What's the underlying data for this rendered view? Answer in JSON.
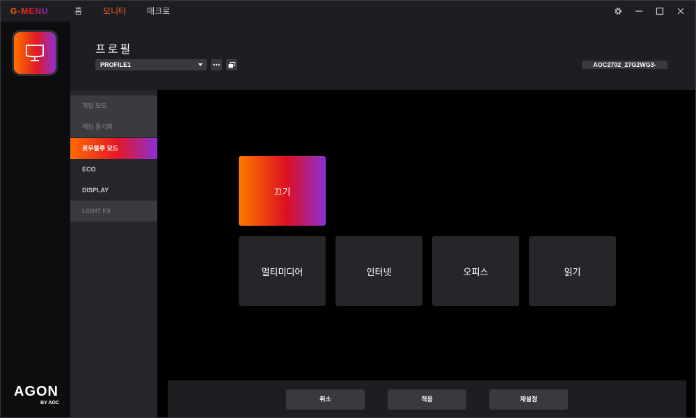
{
  "app": {
    "brand": "G-MENU"
  },
  "nav": {
    "tabs": [
      {
        "label": "홈"
      },
      {
        "label": "모니터"
      },
      {
        "label": "매크로"
      }
    ],
    "active": "모니터"
  },
  "header": {
    "title": "프로필",
    "profile_select": "PROFILE1",
    "monitor_model": "AOC2702_27G2WG3-"
  },
  "submenu": {
    "items": [
      {
        "label": "게임 모드",
        "state": "dim"
      },
      {
        "label": "게임 동기화",
        "state": "dim"
      },
      {
        "label": "로우블루 모드",
        "state": "active"
      },
      {
        "label": "ECO",
        "state": "normal"
      },
      {
        "label": "DISPLAY",
        "state": "normal"
      },
      {
        "label": "LIGHT FX",
        "state": "dim"
      }
    ]
  },
  "modes": {
    "off": "끄기",
    "options": [
      "멀티미디어",
      "인터넷",
      "오피스",
      "읽기"
    ],
    "selected": "끄기"
  },
  "footer": {
    "cancel": "취소",
    "apply": "적용",
    "reset": "재설정"
  },
  "logo": {
    "main": "AGON",
    "sub": "BY AOC"
  },
  "icons": {
    "settings": "gear-icon",
    "minimize": "minimize-icon",
    "maximize": "maximize-icon",
    "close": "close-icon",
    "monitor": "monitor-icon",
    "more": "more-icon",
    "copy": "copy-icon"
  },
  "colors": {
    "accent_orange": "#ff6a00",
    "accent_red": "#e4162a",
    "accent_purple": "#8a2fd5",
    "panel": "#1d1e21",
    "card": "#25262a"
  }
}
